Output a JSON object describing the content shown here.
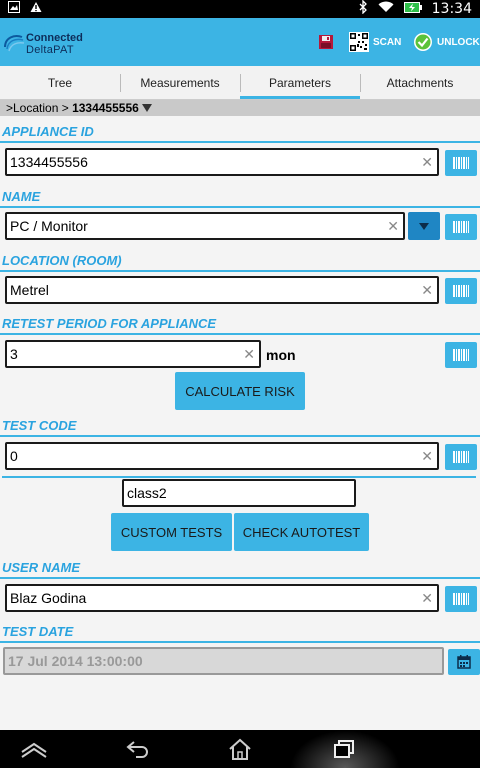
{
  "status_bar": {
    "time": "13:34"
  },
  "app_bar": {
    "logo_line1": "Connected",
    "logo_line2": "DeltaPAT",
    "scan_label": "SCAN",
    "unlock_label": "UNLOCK"
  },
  "tabs": [
    {
      "label": "Tree"
    },
    {
      "label": "Measurements"
    },
    {
      "label": "Parameters",
      "active": true
    },
    {
      "label": "Attachments"
    }
  ],
  "breadcrumb": {
    "prefix": ">Location > ",
    "current": "1334455556"
  },
  "appliance_id": {
    "label": "APPLIANCE ID",
    "value": "1334455556"
  },
  "name": {
    "label": "NAME",
    "value": "PC / Monitor"
  },
  "location": {
    "label": "LOCATION (ROOM)",
    "value": "Metrel"
  },
  "retest": {
    "label": "RETEST PERIOD FOR APPLIANCE",
    "value": "3",
    "unit": "mon",
    "calc_button": "CALCULATE RISK"
  },
  "test_code": {
    "label": "TEST CODE",
    "value": "0",
    "class_value": "class2",
    "custom_button": "CUSTOM TESTS",
    "autotest_button": "CHECK AUTOTEST"
  },
  "user_name": {
    "label": "USER NAME",
    "value": "Blaz Godina"
  },
  "test_date": {
    "label": "TEST DATE",
    "value": "17 Jul 2014 13:00:00"
  },
  "colors": {
    "accent": "#3cb4e4",
    "header_text": "#2aa3df",
    "dropdown": "#1f86c4"
  }
}
